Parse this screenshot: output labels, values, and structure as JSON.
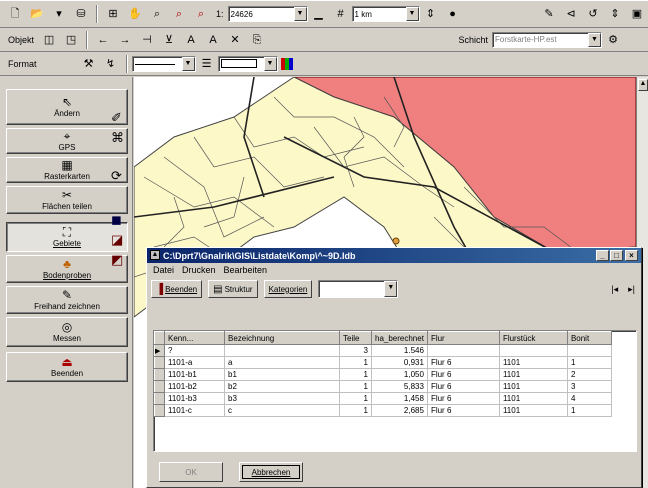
{
  "toolbar1": {
    "scale_prefix": "1:",
    "scale_value": "24626",
    "distance_value": "1 km"
  },
  "toolbar2": {
    "object_label": "Objekt",
    "layer_label": "Schicht",
    "layer_value": "Forstkarte-HP.est"
  },
  "toolbar3": {
    "format_label": "Format"
  },
  "left_buttons": [
    {
      "label": "Ändern",
      "icon": "arrow-icon",
      "glyph": "⇖"
    },
    {
      "label": "GPS",
      "icon": "gps-icon",
      "glyph": "⌖"
    },
    {
      "label": "Rasterkarten",
      "icon": "raster-map-icon",
      "glyph": "▦"
    },
    {
      "label": "Flächen teilen",
      "icon": "split-area-icon",
      "glyph": "✂"
    },
    {
      "label": "Gebiete",
      "icon": "areas-icon",
      "glyph": "⛶"
    },
    {
      "label": "Bodenproben",
      "icon": "soil-sample-icon",
      "glyph": "♣"
    },
    {
      "label": "Freihand zeichnen",
      "icon": "freehand-icon",
      "glyph": "✎"
    },
    {
      "label": "Messen",
      "icon": "measure-icon",
      "glyph": "◎"
    },
    {
      "label": "Beenden",
      "icon": "exit-icon",
      "glyph": "⏏"
    }
  ],
  "window": {
    "title": "C:\\Dprt7\\Gnalrik\\GIS\\Listdate\\Komp\\^~9D.Idb",
    "menu": [
      "Datei",
      "Drucken",
      "Bearbeiten"
    ],
    "toolbar_buttons": [
      "Beenden",
      "Struktur",
      "Kategorien"
    ],
    "nav_prev": "|◂",
    "nav_next": "▸|",
    "columns": [
      "Kenn...",
      "Bezeichnung",
      "Teile",
      "ha_berechnet",
      "Flur",
      "Flurstück",
      "Bonit"
    ],
    "rows": [
      {
        "marker": "▶",
        "kenn": "?",
        "bez": "",
        "teile": "3",
        "ha": "1.546",
        "flur": "",
        "flurstueck": "",
        "bonit": ""
      },
      {
        "marker": "",
        "kenn": "1101-a",
        "bez": "a",
        "teile": "1",
        "ha": "0,931",
        "flur": "Flur 6",
        "flurstueck": "1101",
        "bonit": "1"
      },
      {
        "marker": "",
        "kenn": "1101-b1",
        "bez": "b1",
        "teile": "1",
        "ha": "1,050",
        "flur": "Flur 6",
        "flurstueck": "1101",
        "bonit": "2"
      },
      {
        "marker": "",
        "kenn": "1101-b2",
        "bez": "b2",
        "teile": "1",
        "ha": "5,833",
        "flur": "Flur 6",
        "flurstueck": "1101",
        "bonit": "3"
      },
      {
        "marker": "",
        "kenn": "1101-b3",
        "bez": "b3",
        "teile": "1",
        "ha": "1,458",
        "flur": "Flur 6",
        "flurstueck": "1101",
        "bonit": "4"
      },
      {
        "marker": "",
        "kenn": "1101-c",
        "bez": "c",
        "teile": "1",
        "ha": "2,685",
        "flur": "Flur 6",
        "flurstueck": "1101",
        "bonit": "1"
      }
    ],
    "ok_label": "OK",
    "cancel_label": "Abbrechen"
  },
  "colors": {
    "map_zone_red": "#f08080",
    "map_zone_yellow": "#fdf8c8",
    "map_bg": "#ffffff",
    "titlebar": "#0a246a"
  }
}
